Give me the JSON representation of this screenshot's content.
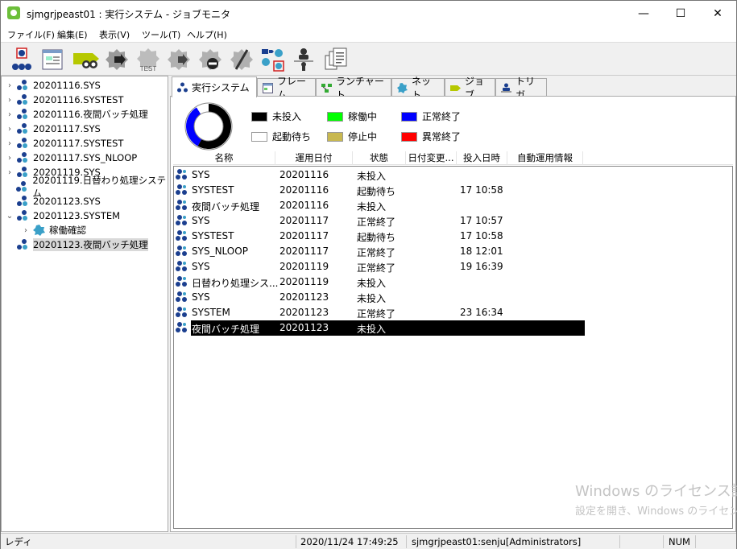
{
  "window": {
    "title": "sjmgrjpeast01 : 実行システム - ジョブモニタ"
  },
  "menu": [
    "ファイル(F)",
    "編集(E)",
    "表示(V)",
    "ツール(T)",
    "ヘルプ(H)"
  ],
  "toolbar": {
    "test_label": "TEST"
  },
  "tree": [
    {
      "label": "20201116.SYS",
      "arrow": "›"
    },
    {
      "label": "20201116.SYSTEST",
      "arrow": "›"
    },
    {
      "label": "20201116.夜間バッチ処理",
      "arrow": "›"
    },
    {
      "label": "20201117.SYS",
      "arrow": "›"
    },
    {
      "label": "20201117.SYSTEST",
      "arrow": "›"
    },
    {
      "label": "20201117.SYS_NLOOP",
      "arrow": "›"
    },
    {
      "label": "20201119.SYS",
      "arrow": "›"
    },
    {
      "label": "20201119.日替わり処理システム",
      "arrow": ""
    },
    {
      "label": "20201123.SYS",
      "arrow": ""
    },
    {
      "label": "20201123.SYSTEM",
      "arrow": "⌄"
    },
    {
      "label": "稼働確認",
      "arrow": "›"
    },
    {
      "label": "20201123.夜間バッチ処理",
      "arrow": ""
    }
  ],
  "tabs": [
    "実行システム",
    "フレーム",
    "ランチャート",
    "ネット",
    "ジョブ",
    "トリガ"
  ],
  "legend": [
    {
      "label": "未投入",
      "color": "#000000"
    },
    {
      "label": "稼働中",
      "color": "#00ff00"
    },
    {
      "label": "正常終了",
      "color": "#0000ff"
    },
    {
      "label": "起動待ち",
      "color": "#ffffff"
    },
    {
      "label": "停止中",
      "color": "#c8b850"
    },
    {
      "label": "異常終了",
      "color": "#ff0000"
    }
  ],
  "columns": [
    "名称",
    "運用日付",
    "状態",
    "日付変更...",
    "投入日時",
    "自動運用情報"
  ],
  "rows": [
    {
      "name": "SYS",
      "date": "20201116",
      "status": "未投入",
      "changed": "",
      "start": "",
      "auto": ""
    },
    {
      "name": "SYSTEST",
      "date": "20201116",
      "status": "起動待ち",
      "changed": "",
      "start": "17 10:58",
      "auto": ""
    },
    {
      "name": "夜間バッチ処理",
      "date": "20201116",
      "status": "未投入",
      "changed": "",
      "start": "",
      "auto": ""
    },
    {
      "name": "SYS",
      "date": "20201117",
      "status": "正常終了",
      "changed": "",
      "start": "17 10:57",
      "auto": ""
    },
    {
      "name": "SYSTEST",
      "date": "20201117",
      "status": "起動待ち",
      "changed": "",
      "start": "17 10:58",
      "auto": ""
    },
    {
      "name": "SYS_NLOOP",
      "date": "20201117",
      "status": "正常終了",
      "changed": "",
      "start": "18 12:01",
      "auto": ""
    },
    {
      "name": "SYS",
      "date": "20201119",
      "status": "正常終了",
      "changed": "",
      "start": "19 16:39",
      "auto": ""
    },
    {
      "name": "日替わり処理シス...",
      "date": "20201119",
      "status": "未投入",
      "changed": "",
      "start": "",
      "auto": ""
    },
    {
      "name": "SYS",
      "date": "20201123",
      "status": "未投入",
      "changed": "",
      "start": "",
      "auto": ""
    },
    {
      "name": "SYSTEM",
      "date": "20201123",
      "status": "正常終了",
      "changed": "",
      "start": "23 16:34",
      "auto": ""
    },
    {
      "name": "夜間バッチ処理",
      "date": "20201123",
      "status": "未投入",
      "changed": "",
      "start": "",
      "auto": ""
    }
  ],
  "donut": {
    "black_fraction": 0.58,
    "blue_fraction": 0.33,
    "white_fraction": 0.09
  },
  "watermark": {
    "line1": "Windows のライセンス認証",
    "line2": "設定を開き、Windows のライセンス"
  },
  "status": {
    "mode": "レディ",
    "datetime": "2020/11/24 17:49:25",
    "user": "sjmgrjpeast01:senju[Administrators]",
    "num": "NUM"
  }
}
